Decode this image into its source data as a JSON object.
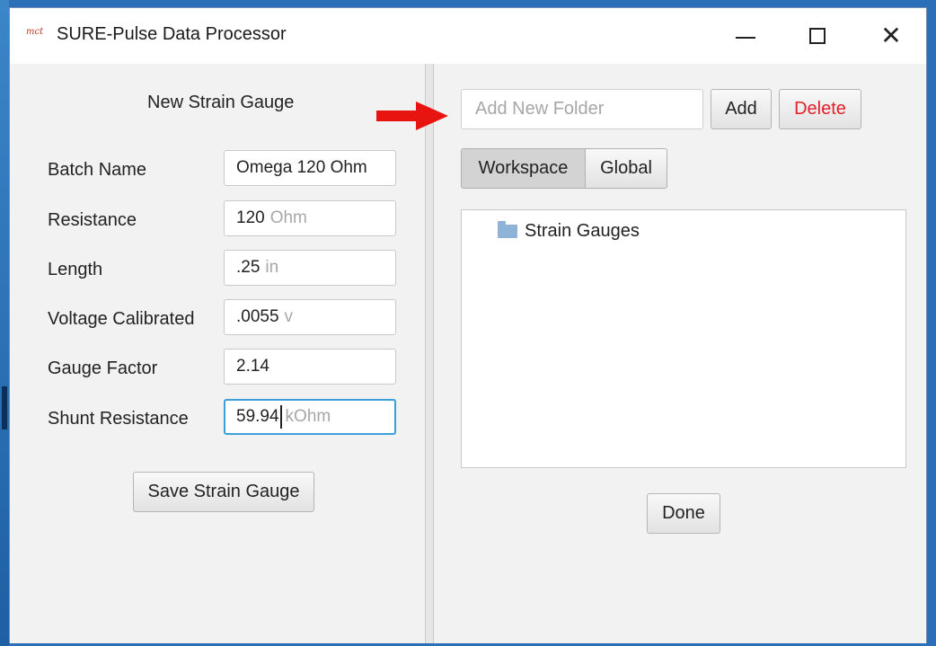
{
  "window": {
    "logo_text": "mct",
    "title": "SURE-Pulse Data Processor",
    "icons": {
      "minimize": "minimize-icon",
      "maximize": "maximize-icon",
      "close": "close-icon"
    }
  },
  "left": {
    "section_title": "New Strain Gauge",
    "fields": [
      {
        "label": "Batch Name",
        "value": "Omega 120 Ohm",
        "unit": ""
      },
      {
        "label": "Resistance",
        "value": "120",
        "unit": "Ohm"
      },
      {
        "label": "Length",
        "value": ".25",
        "unit": "in"
      },
      {
        "label": "Voltage Calibrated",
        "value": ".0055",
        "unit": "v"
      },
      {
        "label": "Gauge Factor",
        "value": "2.14",
        "unit": ""
      },
      {
        "label": "Shunt Resistance",
        "value": "59.94",
        "unit": "kOhm"
      }
    ],
    "save_label": "Save Strain Gauge"
  },
  "right": {
    "folder_placeholder": "Add New Folder",
    "add_label": "Add",
    "delete_label": "Delete",
    "tabs": {
      "workspace": "Workspace",
      "global": "Global",
      "selected": "Workspace"
    },
    "tree": [
      {
        "label": "Strain Gauges",
        "icon": "folder-icon"
      }
    ],
    "done_label": "Done"
  },
  "colors": {
    "delete_text": "#e0202a",
    "focus_border": "#3c9fdc",
    "arrow": "#e8140f",
    "folder": "#8fb3d6"
  }
}
